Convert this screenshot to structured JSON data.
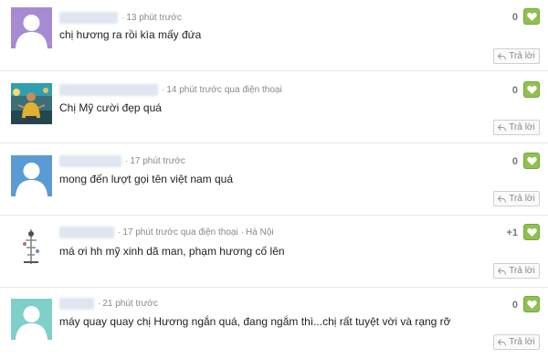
{
  "colors": {
    "avatar_purple": "#a58bd4",
    "avatar_blue": "#5b9bd5",
    "avatar_teal": "#7ed0c8",
    "like_green": "#8fc050",
    "meta_gray": "#888888"
  },
  "comments": [
    {
      "avatar": "default-avatar-purple",
      "time": "13 phút trước",
      "via": "",
      "location": "",
      "text": "chị hương ra rồi kìa mấy đứa",
      "score": "0",
      "reply_label": "Trả lời"
    },
    {
      "avatar": "user-photo-avatar",
      "time": "14 phút trước",
      "via": "qua điện thoại",
      "location": "",
      "text": "Chị Mỹ cười đẹp quá",
      "score": "0",
      "reply_label": "Trả lời"
    },
    {
      "avatar": "default-avatar-blue",
      "time": "17 phút trước",
      "via": "",
      "location": "",
      "text": "mong đến lượt gọi tên việt nam quá",
      "score": "0",
      "reply_label": "Trả lời"
    },
    {
      "avatar": "user-photo-avatar",
      "time": "17 phút trước",
      "via": "qua điện thoại",
      "location": "Hà Nội",
      "text": "má ơi hh mỹ xinh dã man, phạm hương cố lên",
      "score": "+1",
      "reply_label": "Trả lời"
    },
    {
      "avatar": "default-avatar-teal",
      "time": "21 phút trước",
      "via": "",
      "location": "",
      "text": "máy quay quay chị Hương ngắn quá, đang ngắm thì...chị rất tuyệt vời và rạng rỡ",
      "score": "0",
      "reply_label": "Trả lời"
    }
  ]
}
